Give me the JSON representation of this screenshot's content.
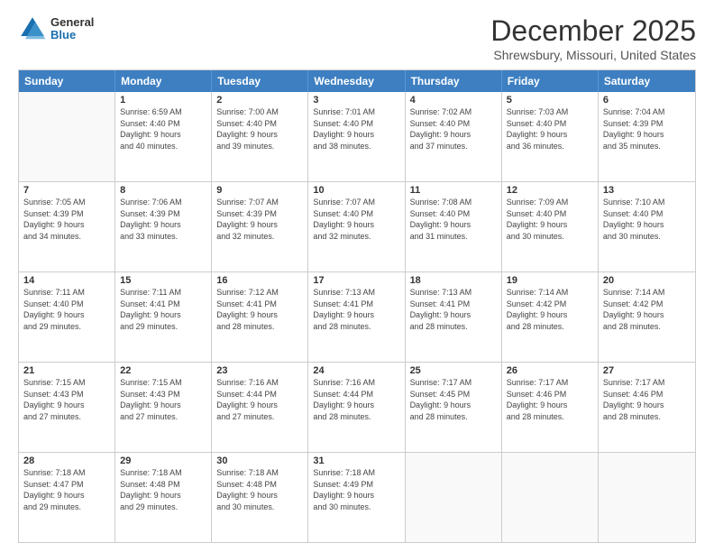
{
  "header": {
    "logo": {
      "general": "General",
      "blue": "Blue"
    },
    "title": "December 2025",
    "location": "Shrewsbury, Missouri, United States"
  },
  "days_of_week": [
    "Sunday",
    "Monday",
    "Tuesday",
    "Wednesday",
    "Thursday",
    "Friday",
    "Saturday"
  ],
  "weeks": [
    [
      {
        "day": "",
        "empty": true
      },
      {
        "day": "1",
        "lines": [
          "Sunrise: 6:59 AM",
          "Sunset: 4:40 PM",
          "Daylight: 9 hours",
          "and 40 minutes."
        ]
      },
      {
        "day": "2",
        "lines": [
          "Sunrise: 7:00 AM",
          "Sunset: 4:40 PM",
          "Daylight: 9 hours",
          "and 39 minutes."
        ]
      },
      {
        "day": "3",
        "lines": [
          "Sunrise: 7:01 AM",
          "Sunset: 4:40 PM",
          "Daylight: 9 hours",
          "and 38 minutes."
        ]
      },
      {
        "day": "4",
        "lines": [
          "Sunrise: 7:02 AM",
          "Sunset: 4:40 PM",
          "Daylight: 9 hours",
          "and 37 minutes."
        ]
      },
      {
        "day": "5",
        "lines": [
          "Sunrise: 7:03 AM",
          "Sunset: 4:40 PM",
          "Daylight: 9 hours",
          "and 36 minutes."
        ]
      },
      {
        "day": "6",
        "lines": [
          "Sunrise: 7:04 AM",
          "Sunset: 4:39 PM",
          "Daylight: 9 hours",
          "and 35 minutes."
        ]
      }
    ],
    [
      {
        "day": "7",
        "lines": [
          "Sunrise: 7:05 AM",
          "Sunset: 4:39 PM",
          "Daylight: 9 hours",
          "and 34 minutes."
        ]
      },
      {
        "day": "8",
        "lines": [
          "Sunrise: 7:06 AM",
          "Sunset: 4:39 PM",
          "Daylight: 9 hours",
          "and 33 minutes."
        ]
      },
      {
        "day": "9",
        "lines": [
          "Sunrise: 7:07 AM",
          "Sunset: 4:39 PM",
          "Daylight: 9 hours",
          "and 32 minutes."
        ]
      },
      {
        "day": "10",
        "lines": [
          "Sunrise: 7:07 AM",
          "Sunset: 4:40 PM",
          "Daylight: 9 hours",
          "and 32 minutes."
        ]
      },
      {
        "day": "11",
        "lines": [
          "Sunrise: 7:08 AM",
          "Sunset: 4:40 PM",
          "Daylight: 9 hours",
          "and 31 minutes."
        ]
      },
      {
        "day": "12",
        "lines": [
          "Sunrise: 7:09 AM",
          "Sunset: 4:40 PM",
          "Daylight: 9 hours",
          "and 30 minutes."
        ]
      },
      {
        "day": "13",
        "lines": [
          "Sunrise: 7:10 AM",
          "Sunset: 4:40 PM",
          "Daylight: 9 hours",
          "and 30 minutes."
        ]
      }
    ],
    [
      {
        "day": "14",
        "lines": [
          "Sunrise: 7:11 AM",
          "Sunset: 4:40 PM",
          "Daylight: 9 hours",
          "and 29 minutes."
        ]
      },
      {
        "day": "15",
        "lines": [
          "Sunrise: 7:11 AM",
          "Sunset: 4:41 PM",
          "Daylight: 9 hours",
          "and 29 minutes."
        ]
      },
      {
        "day": "16",
        "lines": [
          "Sunrise: 7:12 AM",
          "Sunset: 4:41 PM",
          "Daylight: 9 hours",
          "and 28 minutes."
        ]
      },
      {
        "day": "17",
        "lines": [
          "Sunrise: 7:13 AM",
          "Sunset: 4:41 PM",
          "Daylight: 9 hours",
          "and 28 minutes."
        ]
      },
      {
        "day": "18",
        "lines": [
          "Sunrise: 7:13 AM",
          "Sunset: 4:41 PM",
          "Daylight: 9 hours",
          "and 28 minutes."
        ]
      },
      {
        "day": "19",
        "lines": [
          "Sunrise: 7:14 AM",
          "Sunset: 4:42 PM",
          "Daylight: 9 hours",
          "and 28 minutes."
        ]
      },
      {
        "day": "20",
        "lines": [
          "Sunrise: 7:14 AM",
          "Sunset: 4:42 PM",
          "Daylight: 9 hours",
          "and 28 minutes."
        ]
      }
    ],
    [
      {
        "day": "21",
        "lines": [
          "Sunrise: 7:15 AM",
          "Sunset: 4:43 PM",
          "Daylight: 9 hours",
          "and 27 minutes."
        ]
      },
      {
        "day": "22",
        "lines": [
          "Sunrise: 7:15 AM",
          "Sunset: 4:43 PM",
          "Daylight: 9 hours",
          "and 27 minutes."
        ]
      },
      {
        "day": "23",
        "lines": [
          "Sunrise: 7:16 AM",
          "Sunset: 4:44 PM",
          "Daylight: 9 hours",
          "and 27 minutes."
        ]
      },
      {
        "day": "24",
        "lines": [
          "Sunrise: 7:16 AM",
          "Sunset: 4:44 PM",
          "Daylight: 9 hours",
          "and 28 minutes."
        ]
      },
      {
        "day": "25",
        "lines": [
          "Sunrise: 7:17 AM",
          "Sunset: 4:45 PM",
          "Daylight: 9 hours",
          "and 28 minutes."
        ]
      },
      {
        "day": "26",
        "lines": [
          "Sunrise: 7:17 AM",
          "Sunset: 4:46 PM",
          "Daylight: 9 hours",
          "and 28 minutes."
        ]
      },
      {
        "day": "27",
        "lines": [
          "Sunrise: 7:17 AM",
          "Sunset: 4:46 PM",
          "Daylight: 9 hours",
          "and 28 minutes."
        ]
      }
    ],
    [
      {
        "day": "28",
        "lines": [
          "Sunrise: 7:18 AM",
          "Sunset: 4:47 PM",
          "Daylight: 9 hours",
          "and 29 minutes."
        ]
      },
      {
        "day": "29",
        "lines": [
          "Sunrise: 7:18 AM",
          "Sunset: 4:48 PM",
          "Daylight: 9 hours",
          "and 29 minutes."
        ]
      },
      {
        "day": "30",
        "lines": [
          "Sunrise: 7:18 AM",
          "Sunset: 4:48 PM",
          "Daylight: 9 hours",
          "and 30 minutes."
        ]
      },
      {
        "day": "31",
        "lines": [
          "Sunrise: 7:18 AM",
          "Sunset: 4:49 PM",
          "Daylight: 9 hours",
          "and 30 minutes."
        ]
      },
      {
        "day": "",
        "empty": true
      },
      {
        "day": "",
        "empty": true
      },
      {
        "day": "",
        "empty": true
      }
    ]
  ]
}
